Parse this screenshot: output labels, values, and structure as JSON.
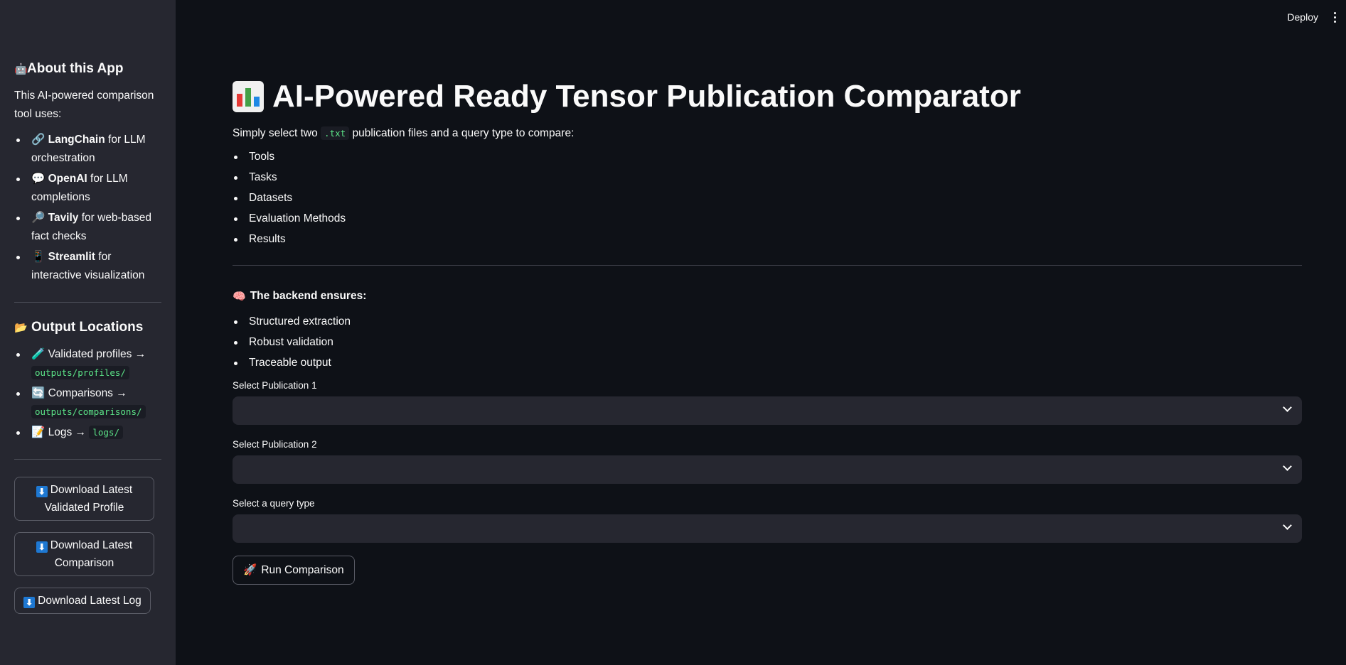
{
  "topbar": {
    "deploy_label": "Deploy"
  },
  "sidebar": {
    "about_heading": "About this App",
    "about_text": "This AI-powered comparison tool uses:",
    "tools": [
      {
        "emoji": "🔗",
        "name": "LangChain",
        "desc": " for LLM orchestration"
      },
      {
        "emoji": "💬",
        "name": "OpenAI",
        "desc": " for LLM completions"
      },
      {
        "emoji": "🔎",
        "name": "Tavily",
        "desc": " for web-based fact checks"
      },
      {
        "emoji": "📱",
        "name": "Streamlit",
        "desc": " for interactive visualization"
      }
    ],
    "output_heading": "Output Locations",
    "outputs": [
      {
        "emoji": "🧪",
        "label": "Validated profiles →",
        "path": "outputs/profiles/"
      },
      {
        "emoji": "🔄",
        "label": "Comparisons →",
        "path": "outputs/comparisons/"
      },
      {
        "emoji": "📝",
        "label": "Logs →",
        "path": "logs/"
      }
    ],
    "buttons": {
      "download_profile": "Download Latest Validated Profile",
      "download_comparison": "Download Latest Comparison",
      "download_log": "Download Latest Log"
    }
  },
  "main": {
    "title": "AI-Powered Ready Tensor Publication Comparator",
    "intro_pre": "Simply select two ",
    "intro_code": ".txt",
    "intro_post": " publication files and a query type to compare:",
    "query_items": [
      "Tools",
      "Tasks",
      "Datasets",
      "Evaluation Methods",
      "Results"
    ],
    "backend_heading": "The backend ensures:",
    "backend_items": [
      "Structured extraction",
      "Robust validation",
      "Traceable output"
    ],
    "select1_label": "Select Publication 1",
    "select2_label": "Select Publication 2",
    "select3_label": "Select a query type",
    "run_button": "Run Comparison"
  },
  "colors": {
    "background": "#0e1117",
    "sidebar": "#262730",
    "code_text": "#5ce488"
  }
}
